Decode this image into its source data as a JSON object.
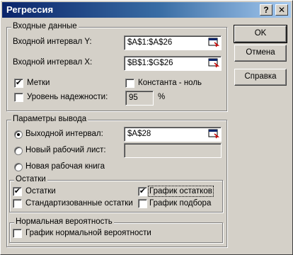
{
  "window": {
    "title": "Регрессия",
    "help_btn": "?",
    "close_btn": "✕"
  },
  "input_group": {
    "legend": "Входные данные",
    "y_label": "Входной интервал Y:",
    "y_value": "$A$1:$A$26",
    "x_label": "Входной интервал X:",
    "x_value": "$B$1:$G$26",
    "labels_label": "Метки",
    "labels_checked": "✔",
    "constant_zero_label": "Константа - ноль",
    "confidence_label": "Уровень надежности:",
    "confidence_value": "95",
    "confidence_unit": "%"
  },
  "output_group": {
    "legend": "Параметры вывода",
    "output_range_label": "Выходной интервал:",
    "output_range_value": "$A$28",
    "new_sheet_label": "Новый рабочий лист:",
    "new_sheet_value": "",
    "new_workbook_label": "Новая рабочая книга"
  },
  "residuals_group": {
    "legend": "Остатки",
    "residuals_label": "Остатки",
    "residuals_checked": "✔",
    "residual_plot_label": "График остатков",
    "residual_plot_checked": "✔",
    "standardized_label": "Стандартизованные остатки",
    "line_fit_label": "График подбора"
  },
  "normal_group": {
    "legend": "Нормальная вероятность",
    "normal_plot_label": "График нормальной вероятности"
  },
  "buttons": {
    "ok": "OK",
    "cancel": "Отмена",
    "help": "Справка"
  }
}
